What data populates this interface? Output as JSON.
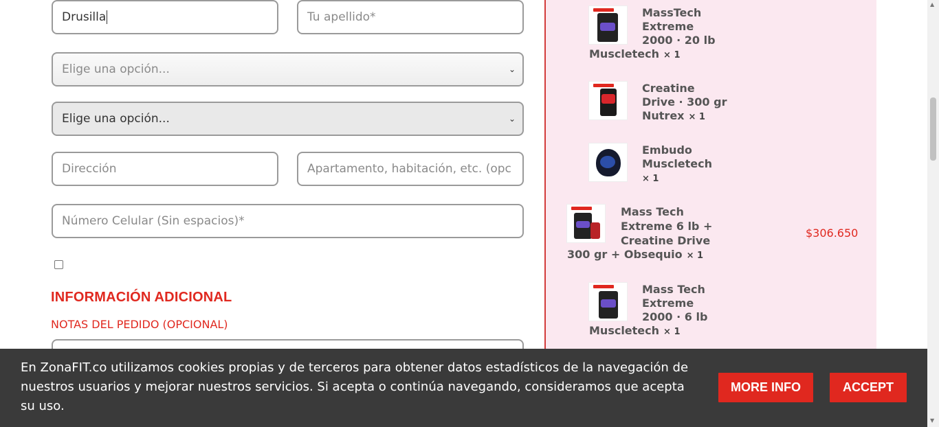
{
  "form": {
    "first_name_value": "Drusilla",
    "last_name_placeholder": "Tu apellido*",
    "select_1_text": "Elige una opción...",
    "select_2_text": "Elige una opción...",
    "address_placeholder": "Dirección",
    "apartment_placeholder": "Apartamento, habitación, etc. (opc",
    "phone_placeholder": "Número Celular (Sin espacios)*",
    "chevron": "⌄"
  },
  "additional": {
    "section_title": "INFORMACIÓN ADICIONAL",
    "notes_label": "NOTAS DEL PEDIDO (OPCIONAL)"
  },
  "order": {
    "items": [
      {
        "name": "MassTech Extreme 2000 · 20 lb Muscletech",
        "qty": "× 1",
        "price": ""
      },
      {
        "name": "Creatine Drive · 300 gr Nutrex",
        "qty": "× 1",
        "price": ""
      },
      {
        "name": "Embudo Muscletech",
        "qty": "× 1",
        "price": ""
      },
      {
        "name": "Mass Tech Extreme 6 lb + Creatine Drive 300 gr + Obsequio",
        "qty": "× 1",
        "price": "$306.650"
      },
      {
        "name": "Mass Tech Extreme 2000 · 6 lb Muscletech",
        "qty": "× 1",
        "price": ""
      }
    ],
    "line_1a": "MassTech",
    "line_1b": "Extreme",
    "line_1c": "2000 · 20 lb",
    "line_1d": "Muscletech",
    "line_2a": "Creatine",
    "line_2b": "Drive · 300 gr",
    "line_2c": "Nutrex",
    "line_3a": "Embudo",
    "line_3b": "Muscletech",
    "line_4a": "Mass Tech",
    "line_4b": "Extreme 6 lb +",
    "line_4c": "Creatine Drive",
    "line_4d": "300 gr + Obsequio",
    "line_5a": "Mass Tech",
    "line_5b": "Extreme",
    "line_5c": "2000 · 6 lb",
    "line_5d": "Muscletech"
  },
  "cookie": {
    "text": "En ZonaFIT.co utilizamos cookies propias y de terceros para obtener datos estadísticos de la navegación de nuestros usuarios y mejorar nuestros servicios. Si acepta o continúa navegando, consideramos que acepta su uso.",
    "more_info_label": "MORE INFO",
    "accept_label": "ACCEPT"
  },
  "colors": {
    "accent_red": "#e0281f",
    "sidebar_bg": "#fbe8f0",
    "cookie_bg": "#3a3a3a"
  }
}
